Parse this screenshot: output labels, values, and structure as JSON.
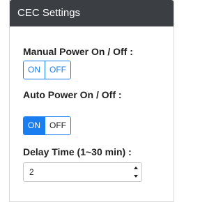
{
  "header": {
    "title": "CEC Settings"
  },
  "manual_power": {
    "label": "Manual Power On / Off :",
    "on_label": "ON",
    "off_label": "OFF",
    "selected": "none"
  },
  "auto_power": {
    "label": "Auto Power On / Off :",
    "on_label": "ON",
    "off_label": "OFF",
    "selected": "ON"
  },
  "delay": {
    "label": "Delay Time (1~30 min) :",
    "value": "2",
    "spinner_icons": [
      "chevron-up-icon",
      "chevron-down-icon"
    ]
  },
  "colors": {
    "header_bg": "#3b3f44",
    "accent": "#1a7ef0"
  }
}
